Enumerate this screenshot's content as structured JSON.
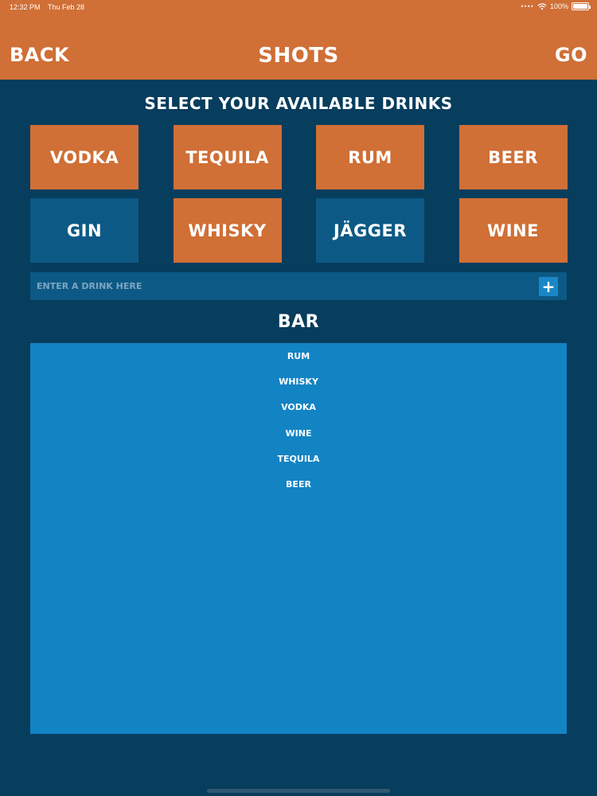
{
  "status": {
    "time": "12:32 PM",
    "date": "Thu Feb 28",
    "battery": "100%"
  },
  "nav": {
    "back_label": "BACK",
    "title": "SHOTS",
    "go_label": "GO"
  },
  "select_title": "SELECT YOUR AVAILABLE DRINKS",
  "drinks": [
    {
      "label": "VODKA",
      "selected": true
    },
    {
      "label": "TEQUILA",
      "selected": true
    },
    {
      "label": "RUM",
      "selected": true
    },
    {
      "label": "BEER",
      "selected": true
    },
    {
      "label": "GIN",
      "selected": false
    },
    {
      "label": "WHISKY",
      "selected": true
    },
    {
      "label": "JÄGGER",
      "selected": false
    },
    {
      "label": "WINE",
      "selected": true
    }
  ],
  "drink_input": {
    "placeholder": "ENTER A DRINK HERE",
    "value": ""
  },
  "add_button_label": "+",
  "bar_title": "BAR",
  "bar_items": [
    "RUM",
    "WHISKY",
    "VODKA",
    "WINE",
    "TEQUILA",
    "BEER"
  ],
  "colors": {
    "accent": "#d06f36",
    "background": "#073d5d",
    "tile_off": "#0d5985",
    "bar_list": "#1283c3"
  }
}
